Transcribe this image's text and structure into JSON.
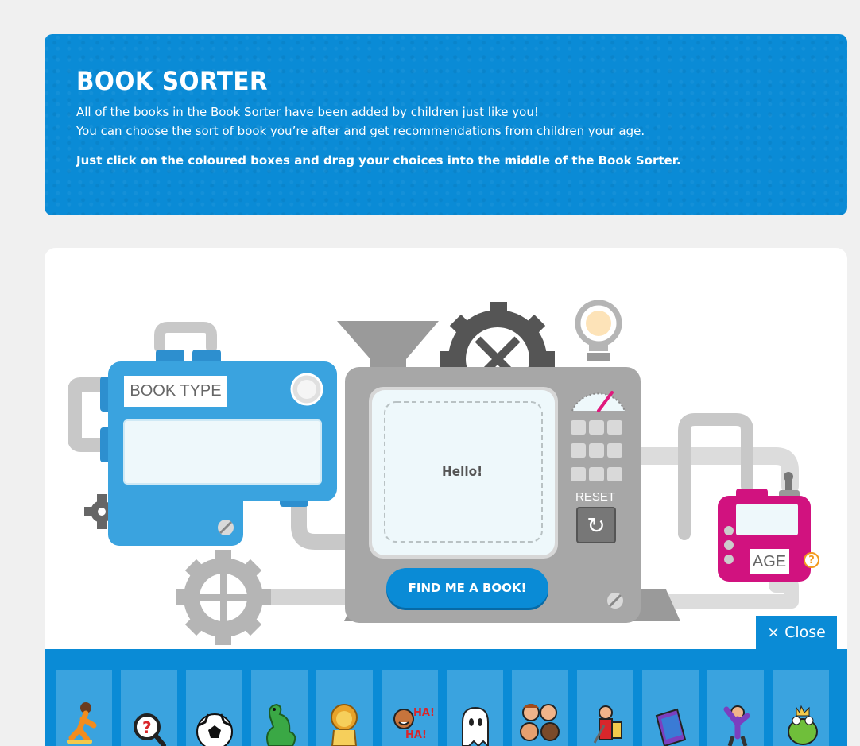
{
  "header": {
    "title": "BOOK SORTER",
    "intro_line1": "All of the books in the Book Sorter have been added by children just like you!",
    "intro_line2": "You can choose the sort of book you’re after and get recommendations from children your age.",
    "instruction": "Just click on the coloured boxes and drag your choices into the middle of the Book Sorter."
  },
  "machine": {
    "book_type_label": "BOOK TYPE",
    "screen_text": "Hello!",
    "find_button": "FIND ME A BOOK!",
    "reset_label": "RESET",
    "reset_icon": "↻",
    "age_label": "AGE",
    "help_icon": "?"
  },
  "tray": {
    "close_label": "× Close",
    "tiles": [
      {
        "icon": "skateboarder-icon"
      },
      {
        "icon": "magnifier-question-icon"
      },
      {
        "icon": "football-icon"
      },
      {
        "icon": "dragon-icon"
      },
      {
        "icon": "lion-icon"
      },
      {
        "icon": "laughing-child-icon"
      },
      {
        "icon": "ghost-icon"
      },
      {
        "icon": "children-group-icon"
      },
      {
        "icon": "knight-icon"
      },
      {
        "icon": "book-icon"
      },
      {
        "icon": "robot-man-icon"
      },
      {
        "icon": "frog-prince-icon"
      }
    ]
  },
  "colors": {
    "brand_blue": "#0a8bd6",
    "machine_grey": "#a7a7a7",
    "pink_box": "#d1127f",
    "box_blue": "#3aa3df"
  }
}
